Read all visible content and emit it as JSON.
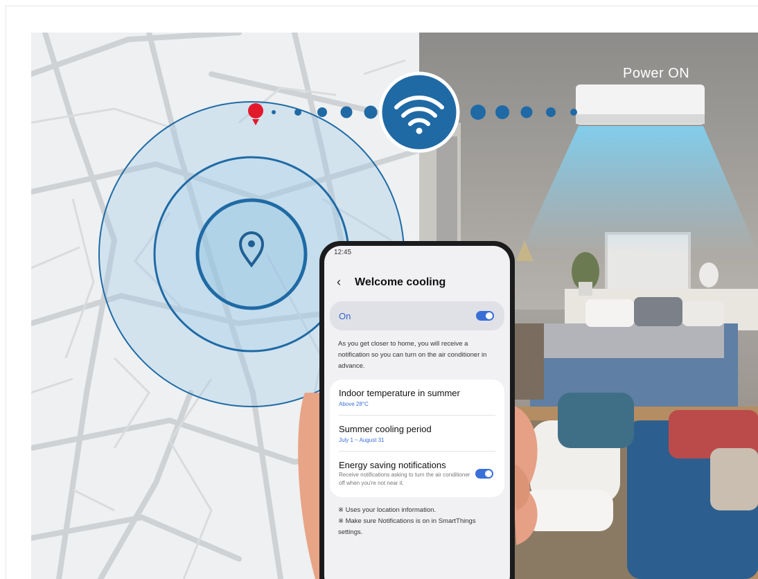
{
  "overlay": {
    "power_label": "Power ON"
  },
  "phone": {
    "time": "12:45",
    "back_icon": "chevron-left-icon",
    "title": "Welcome cooling",
    "toggle_label": "On",
    "toggle_on": true,
    "description": "As you get closer to home, you will receive a notification so you can turn on the air conditioner in advance.",
    "settings": [
      {
        "title": "Indoor temperature in summer",
        "value": "Above 28°C"
      },
      {
        "title": "Summer cooling period",
        "value": "July 1 ~ August 31"
      },
      {
        "title": "Energy saving notifications",
        "subtitle": "Receive notifications asking to turn the air conditioner off when you're not near it.",
        "toggle_on": true
      }
    ],
    "notes": [
      "※ Uses your location information.",
      "※ Make sure Notifications is on in SmartThings settings."
    ]
  },
  "colors": {
    "accent": "#3a6fd8",
    "wifi_blue": "#1f6aa5",
    "pin_red": "#e21a2c"
  }
}
